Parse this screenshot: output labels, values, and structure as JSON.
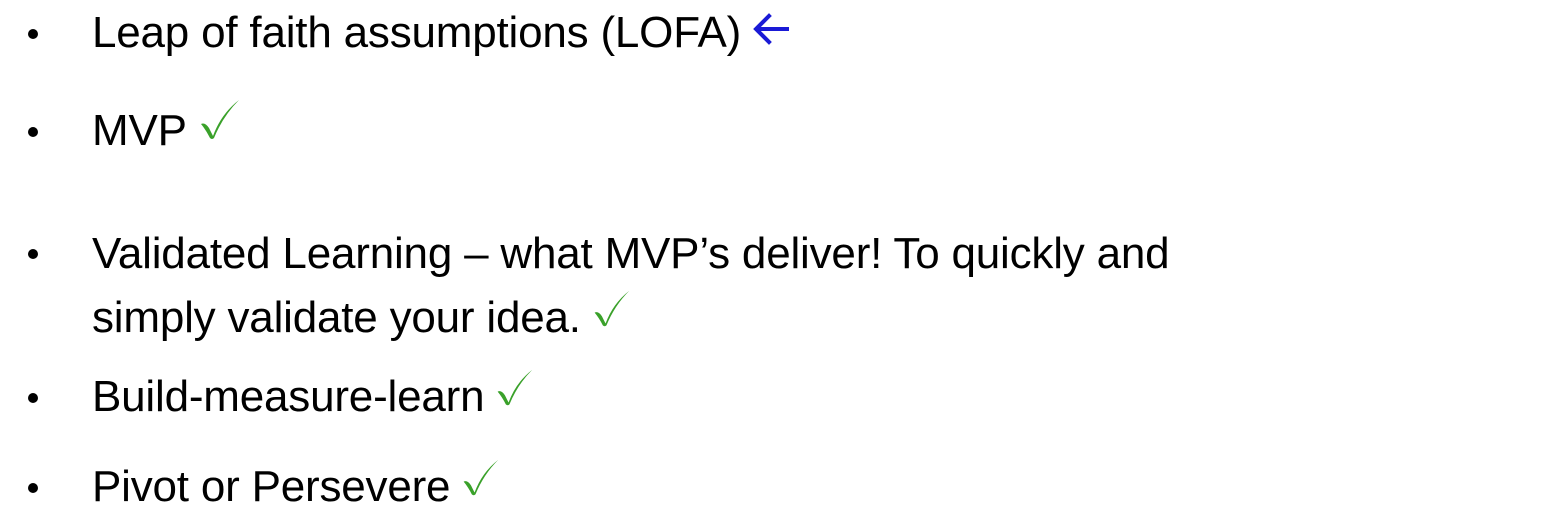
{
  "bullets": [
    {
      "text": "Leap of faith assumptions (LOFA)",
      "marker": "arrow-left-icon",
      "marker_color": "#1a1ad6"
    },
    {
      "text": "MVP",
      "marker": "check-icon",
      "marker_color": "#3aa12a"
    },
    {
      "line1": "Validated Learning – what MVP’s deliver! To quickly and",
      "line2": "simply validate your idea.",
      "marker": "check-icon",
      "marker_color": "#3aa12a"
    },
    {
      "text": "Build-measure-learn",
      "marker": "check-icon",
      "marker_color": "#3aa12a"
    },
    {
      "text": "Pivot or Persevere",
      "marker": "check-icon",
      "marker_color": "#3aa12a"
    }
  ]
}
